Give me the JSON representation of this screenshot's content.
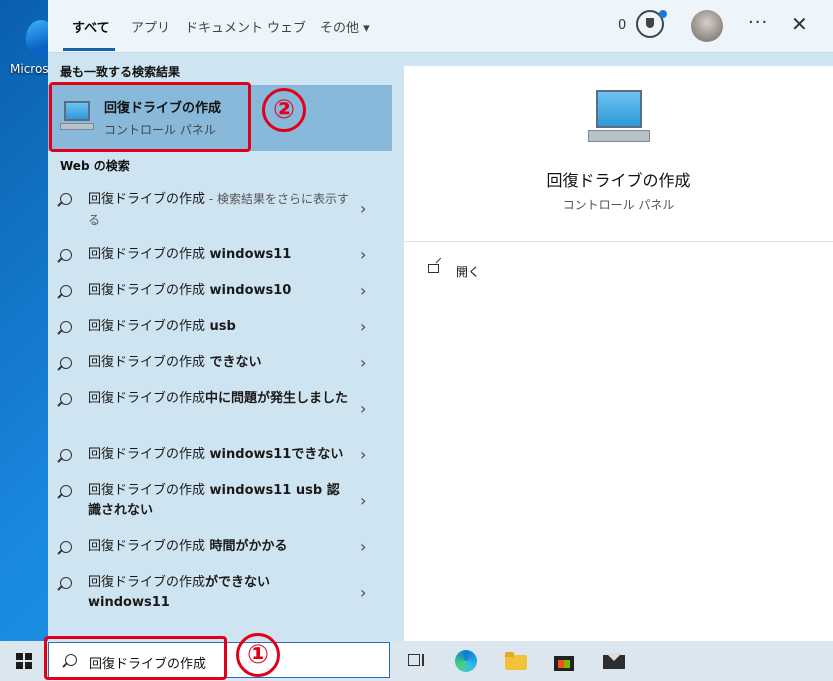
{
  "desktop": {
    "icon_label": "Micros"
  },
  "tabs": [
    {
      "label": "すべて",
      "active": true
    },
    {
      "label": "アプリ"
    },
    {
      "label": "ドキュメント"
    },
    {
      "label": "ウェブ"
    },
    {
      "label": "その他 ▾"
    }
  ],
  "topbar": {
    "rewards_count": "0",
    "more": "···",
    "close": "✕"
  },
  "best_match": {
    "heading": "最も一致する検索結果",
    "title": "回復ドライブの作成",
    "subtitle": "コントロール パネル",
    "annotation": "②"
  },
  "web": {
    "heading": "Web の検索",
    "results": [
      {
        "query": "回復ドライブの作成",
        "suffix": "",
        "gray": " - 検索結果をさらに表示する"
      },
      {
        "query": "回復ドライブの作成",
        "suffix": " windows11",
        "gray": ""
      },
      {
        "query": "回復ドライブの作成",
        "suffix": " windows10",
        "gray": ""
      },
      {
        "query": "回復ドライブの作成",
        "suffix": " usb",
        "gray": ""
      },
      {
        "query": "回復ドライブの作成",
        "suffix": " できない",
        "gray": ""
      },
      {
        "query": "回復ドライブの作成",
        "suffix": "中に問題が発生しました",
        "gray": ""
      },
      {
        "query": "回復ドライブの作成",
        "suffix": " windows11できない",
        "gray": ""
      },
      {
        "query": "回復ドライブの作成",
        "suffix": " windows11 usb 認識されない",
        "gray": ""
      },
      {
        "query": "回復ドライブの作成",
        "suffix": " 時間がかかる",
        "gray": ""
      },
      {
        "query": "回復ドライブの作成",
        "suffix": "ができない windows11",
        "gray": ""
      }
    ]
  },
  "detail": {
    "title": "回復ドライブの作成",
    "subtitle": "コントロール パネル",
    "open_label": "開く"
  },
  "taskbar": {
    "search_value": "回復ドライブの作成",
    "annotation": "①"
  },
  "colors": {
    "accent": "#1a5fa8",
    "highlight": "#88b9da",
    "annotation_red": "#e0001a"
  }
}
